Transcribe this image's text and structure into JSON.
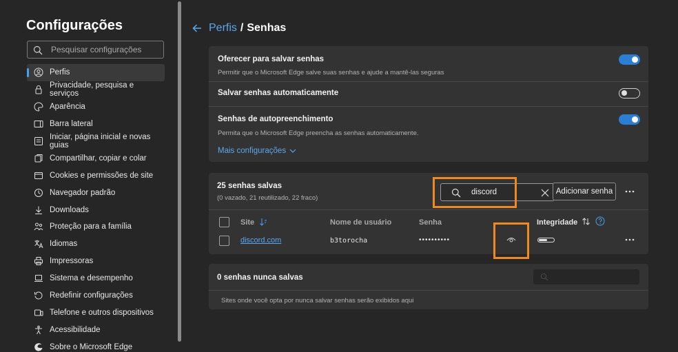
{
  "sidebar": {
    "title": "Configurações",
    "search_placeholder": "Pesquisar configurações",
    "items": [
      {
        "label": "Perfis",
        "icon": "profile-icon",
        "active": true
      },
      {
        "label": "Privacidade, pesquisa e serviços",
        "icon": "lock-icon"
      },
      {
        "label": "Aparência",
        "icon": "palette-icon"
      },
      {
        "label": "Barra lateral",
        "icon": "sidebar-icon"
      },
      {
        "label": "Iniciar, página inicial e novas guias",
        "icon": "home-tabs-icon"
      },
      {
        "label": "Compartilhar, copiar e colar",
        "icon": "share-icon"
      },
      {
        "label": "Cookies e permissões de site",
        "icon": "cookie-icon"
      },
      {
        "label": "Navegador padrão",
        "icon": "browser-icon"
      },
      {
        "label": "Downloads",
        "icon": "download-icon"
      },
      {
        "label": "Proteção para a família",
        "icon": "family-icon"
      },
      {
        "label": "Idiomas",
        "icon": "language-icon"
      },
      {
        "label": "Impressoras",
        "icon": "printer-icon"
      },
      {
        "label": "Sistema e desempenho",
        "icon": "laptop-icon"
      },
      {
        "label": "Redefinir configurações",
        "icon": "reset-icon"
      },
      {
        "label": "Telefone e outros dispositivos",
        "icon": "phone-icon"
      },
      {
        "label": "Acessibilidade",
        "icon": "accessibility-icon"
      },
      {
        "label": "Sobre o Microsoft Edge",
        "icon": "edge-icon"
      }
    ]
  },
  "breadcrumb": {
    "parent": "Perfis",
    "separator": "/",
    "current": "Senhas"
  },
  "settings": {
    "offer_save": {
      "title": "Oferecer para salvar senhas",
      "desc": "Permitir que o Microsoft Edge salve suas senhas e ajude a mantê-las seguras",
      "on": true
    },
    "auto_save": {
      "title": "Salvar senhas automaticamente",
      "on": false
    },
    "autofill": {
      "title": "Senhas de autopreenchimento",
      "desc": "Permita que o Microsoft Edge preencha as senhas automaticamente.",
      "on": true
    },
    "more_link": "Mais configurações"
  },
  "saved": {
    "count_label": "25 senhas salvas",
    "summary": "(0 vazado, 21 reutilizado, 22 fraco)",
    "search_value": "discord",
    "add_button": "Adicionar senha",
    "columns": {
      "site": "Site",
      "username": "Nome de usuário",
      "password": "Senha",
      "health": "Integridade"
    },
    "rows": [
      {
        "site": "discord.com",
        "username": "b3torocha",
        "password": "••••••••••",
        "strength": 0.55
      }
    ]
  },
  "never_saved": {
    "title": "0 senhas nunca salvas",
    "desc": "Sites onde você opta por nunca salvar senhas serão exibidos aqui"
  },
  "colors": {
    "accent": "#2a7fd4",
    "link": "#5aa8ef",
    "highlight": "#f08a1e",
    "card": "#333333",
    "background": "#262626"
  }
}
